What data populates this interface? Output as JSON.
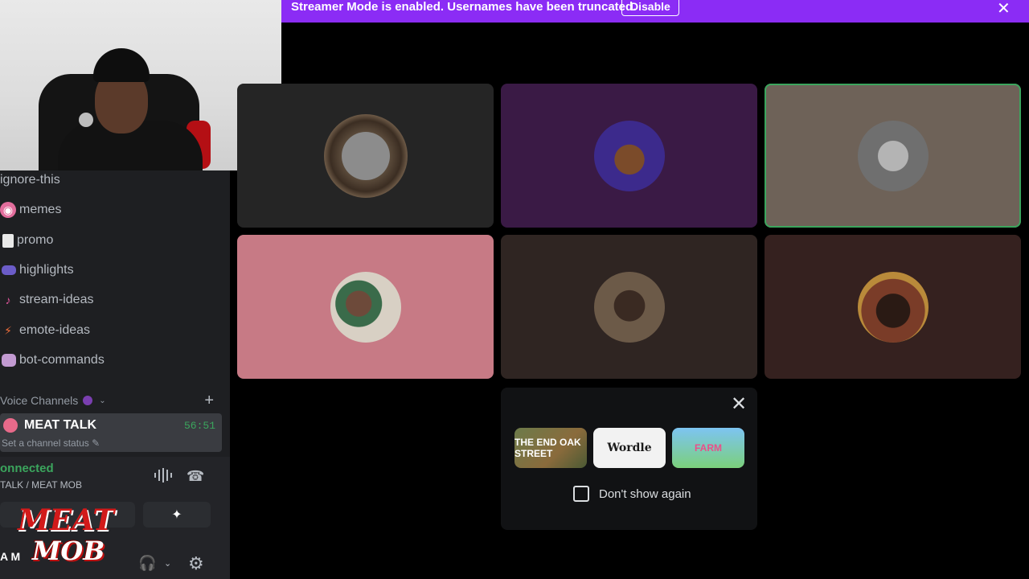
{
  "streamer_bar": {
    "message": "Streamer Mode is enabled. Usernames have been truncated.",
    "disable_label": "Disable",
    "close_icon": "close-icon",
    "color": "#8b2cf5"
  },
  "channels": [
    {
      "name": "ignore-this",
      "icon": ""
    },
    {
      "name": "memes",
      "icon": "memes-emoji-icon"
    },
    {
      "name": "promo",
      "icon": "page-emoji-icon"
    },
    {
      "name": "highlights",
      "icon": "video-emoji-icon"
    },
    {
      "name": "stream-ideas",
      "icon": "music-emoji-icon"
    },
    {
      "name": "emote-ideas",
      "icon": "lightning-emoji-icon"
    },
    {
      "name": "bot-commands",
      "icon": "robot-emoji-icon"
    }
  ],
  "voice_section": {
    "label": "Voice Channels",
    "add_icon": "plus-icon"
  },
  "voice_channel": {
    "name": "MEAT TALK",
    "timer": "56:51",
    "status_placeholder": "Set a channel status"
  },
  "connection": {
    "title": "onnected",
    "subtitle": "TALK / MEAT MOB"
  },
  "user": {
    "name": "A M"
  },
  "logo": {
    "line1": "MEAT",
    "line2": "MOB"
  },
  "activities": {
    "games": [
      "THE END OAK STREET",
      "Wordle",
      "FARM"
    ],
    "dont_show_label": "Don't show again",
    "dont_show_checked": false
  },
  "colors": {
    "tile1": "#252525",
    "tile2": "#3a1a45",
    "tile3": "#6e6258",
    "tile4": "#c77a85",
    "tile5": "#2f2522",
    "tile6": "#35211f",
    "speaking": "#3ba55d",
    "connected": "#3ba55d"
  }
}
